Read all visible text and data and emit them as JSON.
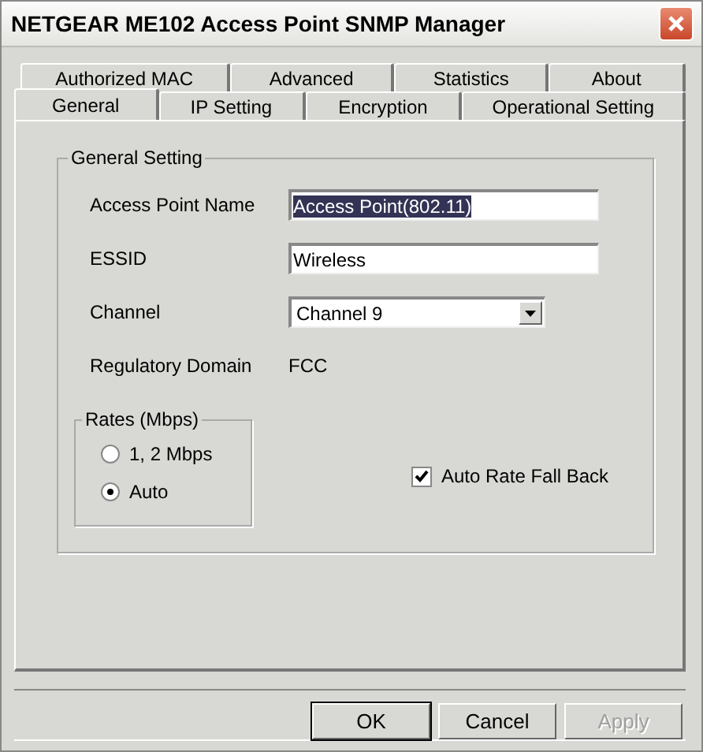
{
  "window": {
    "title": "NETGEAR ME102 Access Point SNMP Manager"
  },
  "tab_rows": [
    [
      {
        "label": "Authorized MAC",
        "selected": false
      },
      {
        "label": "Advanced",
        "selected": false
      },
      {
        "label": "Statistics",
        "selected": false
      },
      {
        "label": "About",
        "selected": false
      }
    ],
    [
      {
        "label": "General",
        "selected": true
      },
      {
        "label": "IP Setting",
        "selected": false
      },
      {
        "label": "Encryption",
        "selected": false
      },
      {
        "label": "Operational Setting",
        "selected": false
      }
    ]
  ],
  "general_setting": {
    "title": "General Setting",
    "fields": [
      {
        "kind": "text",
        "label": "Access Point Name",
        "value": "Access Point(802.11)",
        "text_selected": true
      },
      {
        "kind": "text",
        "label": "ESSID",
        "value": "Wireless",
        "text_selected": false
      },
      {
        "kind": "dropdown",
        "label": "Channel",
        "value": "Channel 9"
      },
      {
        "kind": "static",
        "label": "Regulatory Domain",
        "value": "FCC"
      }
    ],
    "rates": {
      "title": "Rates (Mbps)",
      "options": [
        {
          "label": "1, 2 Mbps",
          "selected": false
        },
        {
          "label": "Auto",
          "selected": true
        }
      ]
    },
    "auto_rate_fall_back": {
      "label": "Auto Rate Fall Back",
      "checked": true
    }
  },
  "buttons": [
    {
      "label": "OK",
      "default": true,
      "disabled": false
    },
    {
      "label": "Cancel",
      "default": false,
      "disabled": false
    },
    {
      "label": "Apply",
      "default": false,
      "disabled": true
    }
  ]
}
